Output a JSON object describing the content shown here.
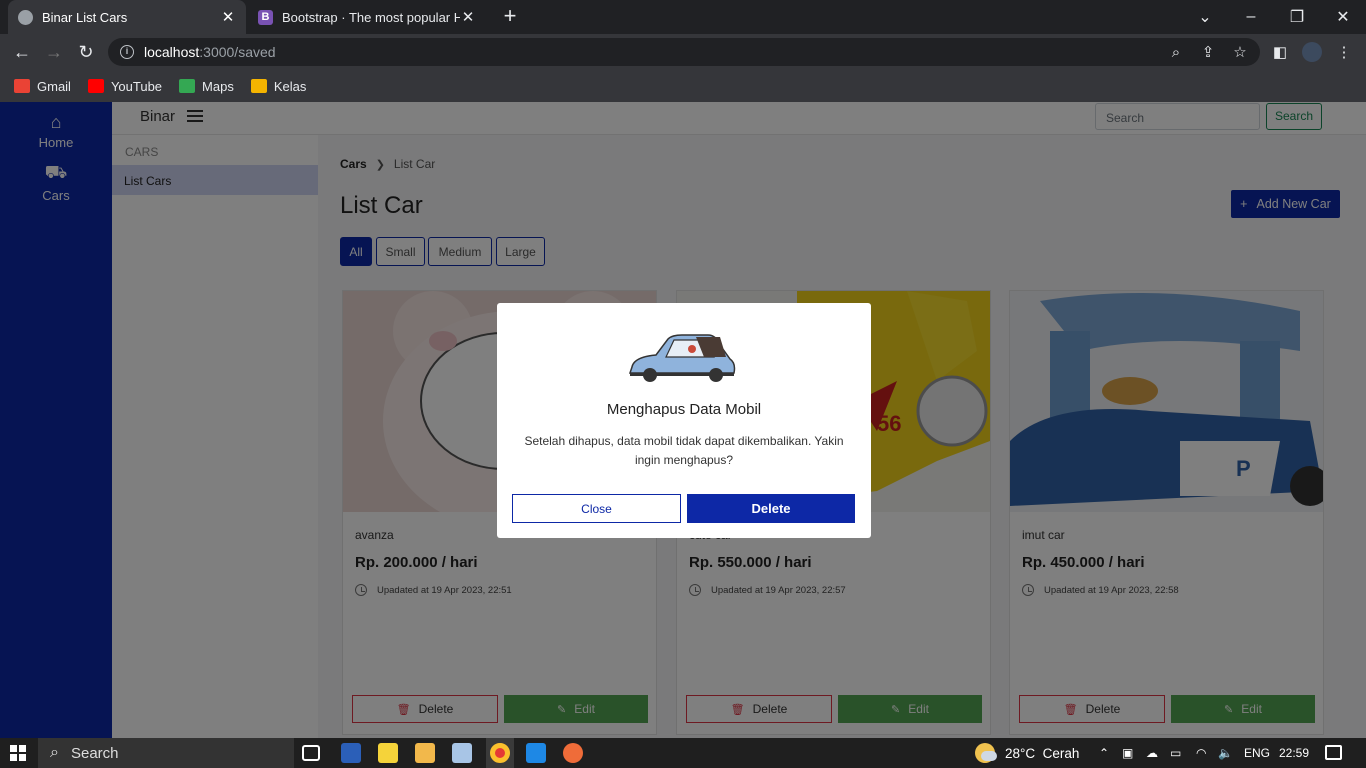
{
  "browser": {
    "tabs": [
      {
        "title": "Binar List Cars",
        "active": true
      },
      {
        "title": "Bootstrap · The most popular HTML",
        "active": false
      }
    ],
    "url_host": "localhost",
    "url_rest": ":3000/saved",
    "bookmarks": [
      {
        "label": "Gmail",
        "icon": "gmail-icon",
        "color": "#ea4335"
      },
      {
        "label": "YouTube",
        "icon": "youtube-icon",
        "color": "#ff0000"
      },
      {
        "label": "Maps",
        "icon": "maps-icon",
        "color": "#34a853"
      },
      {
        "label": "Kelas",
        "icon": "classroom-icon",
        "color": "#f4b400"
      }
    ]
  },
  "sidebar": {
    "items": [
      {
        "label": "Home",
        "icon": "home-icon"
      },
      {
        "label": "Cars",
        "icon": "truck-icon"
      }
    ]
  },
  "topnav": {
    "brand": "Binar",
    "search_placeholder": "Search",
    "search_button": "Search"
  },
  "subside": {
    "heading": "CARS",
    "item": "List Cars"
  },
  "breadcrumb": {
    "root": "Cars",
    "current": "List Car"
  },
  "page": {
    "title": "List Car",
    "add_button": "Add New Car",
    "filters": [
      "All",
      "Small",
      "Medium",
      "Large"
    ],
    "active_filter": "All"
  },
  "cars": [
    {
      "name": "avanza",
      "price": "Rp. 200.000 / hari",
      "updated": "Upadated at 19 Apr 2023, 22:51",
      "delete": "Delete",
      "edit": "Edit"
    },
    {
      "name": "cute car",
      "price": "Rp. 550.000 / hari",
      "updated": "Upadated at 19 Apr 2023, 22:57",
      "delete": "Delete",
      "edit": "Edit"
    },
    {
      "name": "imut car",
      "price": "Rp. 450.000 / hari",
      "updated": "Upadated at 19 Apr 2023, 22:58",
      "delete": "Delete",
      "edit": "Edit"
    }
  ],
  "modal": {
    "title": "Menghapus Data Mobil",
    "body": "Setelah dihapus, data mobil tidak dapat dikembalikan. Yakin ingin menghapus?",
    "close": "Close",
    "delete": "Delete"
  },
  "taskbar": {
    "search": "Search",
    "weather": "28°C  Cerah",
    "lang": "ENG",
    "time": "22:59"
  },
  "colors": {
    "primary": "#0d28a6",
    "success": "#52a552",
    "danger": "#dc3545"
  }
}
